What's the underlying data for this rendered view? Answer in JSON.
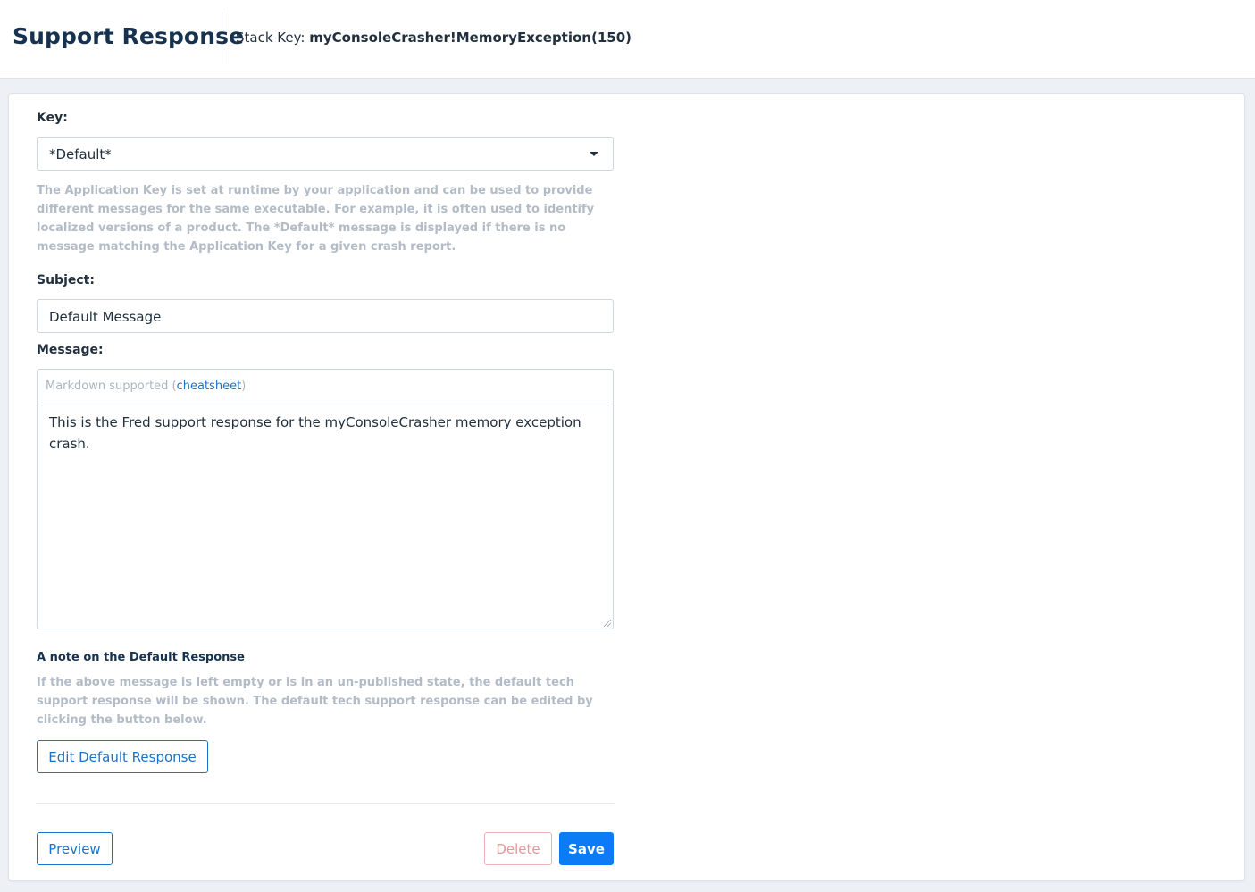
{
  "header": {
    "title": "Support Response",
    "stack_key_label": "Stack Key:",
    "stack_key_value": "myConsoleCrasher!MemoryException(150)"
  },
  "form": {
    "key": {
      "label": "Key:",
      "selected": "*Default*",
      "help": "The Application Key is set at runtime by your application and can be used to provide different messages for the same executable. For example, it is often used to identify localized versions of a product. The *Default* message is displayed if there is no message matching the Application Key for a given crash report."
    },
    "subject": {
      "label": "Subject:",
      "value": "Default Message"
    },
    "message": {
      "label": "Message:",
      "toolbar_prefix": "Markdown supported (",
      "cheatsheet_link": "cheatsheet",
      "toolbar_suffix": ")",
      "value": "This is the Fred support response for the myConsoleCrasher memory exception crash."
    },
    "note": {
      "title": "A note on the Default Response",
      "text": "If the above message is left empty or is in an un-published state, the default tech support response will be shown. The default tech support response can be edited by clicking the button below.",
      "edit_button": "Edit Default Response"
    }
  },
  "actions": {
    "preview": "Preview",
    "delete": "Delete",
    "save": "Save"
  }
}
